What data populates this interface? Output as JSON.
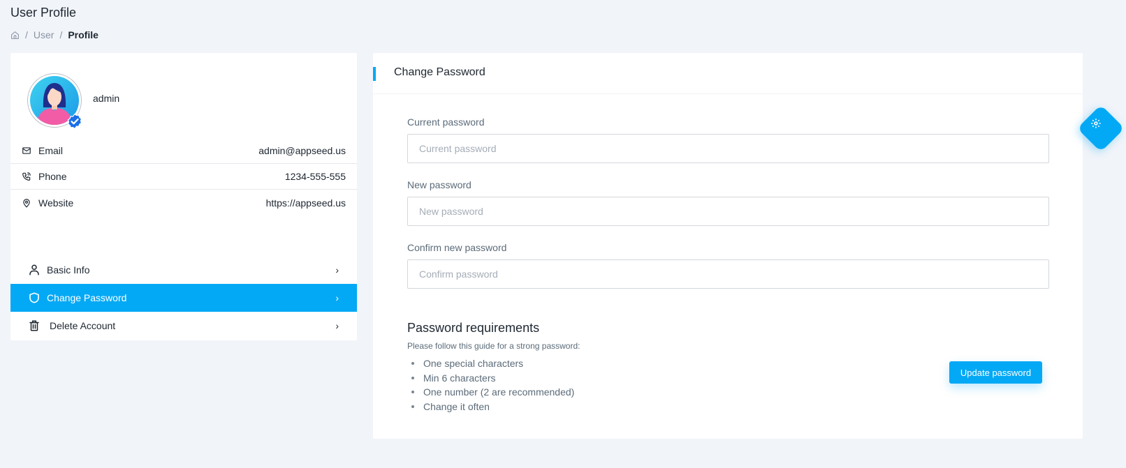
{
  "page": {
    "title": "User Profile",
    "breadcrumb": {
      "home_icon": "home-icon",
      "separator": "/",
      "items": [
        "User",
        "Profile"
      ]
    }
  },
  "profile": {
    "username": "admin",
    "avatar": "female-user-avatar",
    "verified_badge": "verified-badge-icon",
    "info": [
      {
        "icon": "mail-icon",
        "label": "Email",
        "value": "admin@appseed.us"
      },
      {
        "icon": "phone-icon",
        "label": "Phone",
        "value": "1234-555-555"
      },
      {
        "icon": "map-pin-icon",
        "label": "Website",
        "value": "https://appseed.us"
      }
    ],
    "menu": [
      {
        "icon": "user-icon",
        "label": "Basic Info",
        "active": false
      },
      {
        "icon": "shield-icon",
        "label": "Change Password",
        "active": true
      },
      {
        "icon": "trash-icon",
        "label": "Delete Account",
        "active": false
      }
    ],
    "chevron": "›"
  },
  "change_password": {
    "title": "Change Password",
    "fields": [
      {
        "label": "Current password",
        "placeholder": "Current password",
        "value": ""
      },
      {
        "label": "New password",
        "placeholder": "New password",
        "value": ""
      },
      {
        "label": "Confirm new password",
        "placeholder": "Confirm password",
        "value": ""
      }
    ],
    "requirements": {
      "heading": "Password requirements",
      "intro": "Please follow this guide for a strong password:",
      "items": [
        "One special characters",
        "Min 6 characters",
        "One number (2 are recommended)",
        "Change it often"
      ]
    },
    "submit_label": "Update password"
  },
  "colors": {
    "accent": "#04a9f5",
    "background": "#f1f4f9",
    "text": "#1d2630",
    "muted": "#5b6b79"
  }
}
